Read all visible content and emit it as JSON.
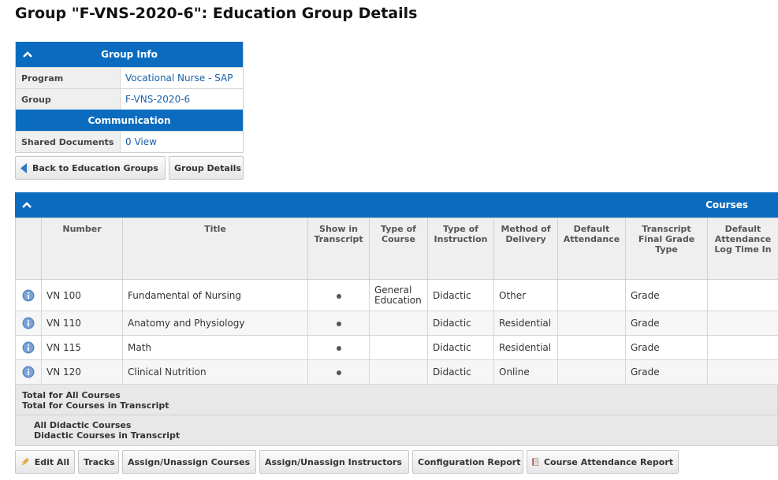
{
  "page": {
    "title": "Group \"F-VNS-2020-6\": Education Group Details"
  },
  "group_info": {
    "header": "Group Info",
    "rows": [
      {
        "label": "Program",
        "value": "Vocational Nurse - SAP"
      },
      {
        "label": "Group",
        "value": "F-VNS-2020-6"
      }
    ],
    "communication_header": "Communication",
    "shared_documents": {
      "label": "Shared Documents",
      "value": "0 View"
    }
  },
  "nav_buttons": {
    "back": "Back to Education Groups",
    "details": "Group Details"
  },
  "courses": {
    "header": "Courses",
    "columns": [
      "Number",
      "Title",
      "Show in Transcript",
      "Type of Course",
      "Type of Instruction",
      "Method of Delivery",
      "Default Attendance",
      "Transcript Final Grade Type",
      "Default Attendance Log Time In"
    ],
    "rows": [
      {
        "number": "VN 100",
        "title": "Fundamental of Nursing",
        "type_of_course": "General Education",
        "type_of_instruction": "Didactic",
        "method": "Other",
        "grade_type": "Grade"
      },
      {
        "number": "VN 110",
        "title": "Anatomy and Physiology",
        "type_of_course": "",
        "type_of_instruction": "Didactic",
        "method": "Residential",
        "grade_type": "Grade"
      },
      {
        "number": "VN 115",
        "title": "Math",
        "type_of_course": "",
        "type_of_instruction": "Didactic",
        "method": "Residential",
        "grade_type": "Grade"
      },
      {
        "number": "VN 120",
        "title": "Clinical Nutrition",
        "type_of_course": "",
        "type_of_instruction": "Didactic",
        "method": "Online",
        "grade_type": "Grade"
      }
    ],
    "totals": {
      "all": "Total for All Courses",
      "transcript": "Total for Courses in Transcript",
      "didactic_all": "All Didactic Courses",
      "didactic_transcript": "Didactic Courses in Transcript"
    }
  },
  "toolbar": {
    "edit_all": "Edit All",
    "tracks": "Tracks",
    "assign_courses": "Assign/Unassign Courses",
    "assign_instructors": "Assign/Unassign Instructors",
    "config_report": "Configuration Report",
    "attendance_report": "Course Attendance Report"
  },
  "colors": {
    "header_blue": "#0b6cbf",
    "link_blue": "#1a5fa8"
  }
}
